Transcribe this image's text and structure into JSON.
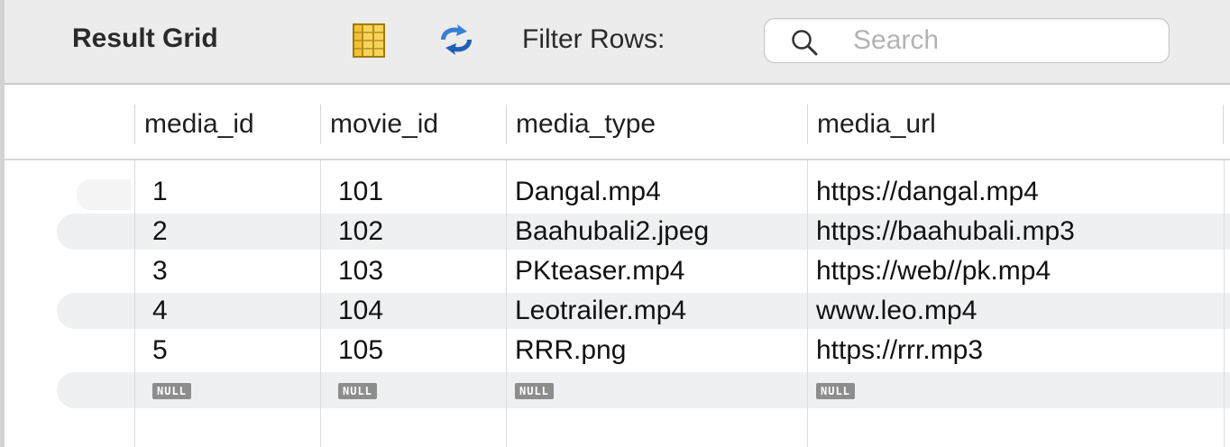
{
  "toolbar": {
    "title": "Result Grid",
    "grid_icon": "form-grid-icon",
    "refresh_icon": "refresh-arrows-icon",
    "filter_label": "Filter Rows:",
    "search_placeholder": "Search",
    "search_value": "",
    "search_icon": "magnifier-icon"
  },
  "grid": {
    "columns": [
      "media_id",
      "movie_id",
      "media_type",
      "media_url"
    ],
    "rows": [
      [
        "1",
        "101",
        "Dangal.mp4",
        "https://dangal.mp4"
      ],
      [
        "2",
        "102",
        "Baahubali2.jpeg",
        "https://baahubali.mp3"
      ],
      [
        "3",
        "103",
        "PKteaser.mp4",
        "https://web//pk.mp4"
      ],
      [
        "4",
        "104",
        "Leotrailer.mp4",
        "www.leo.mp4"
      ],
      [
        "5",
        "105",
        "RRR.png",
        "https://rrr.mp3"
      ]
    ],
    "null_label": "NULL"
  },
  "colors": {
    "toolbar_bg": "#ececec",
    "stripe": "#eef0f2",
    "null_badge": "#8d8d8d",
    "refresh_blue": "#3a7fd6",
    "grid_icon_yellow": "#f2c230"
  }
}
